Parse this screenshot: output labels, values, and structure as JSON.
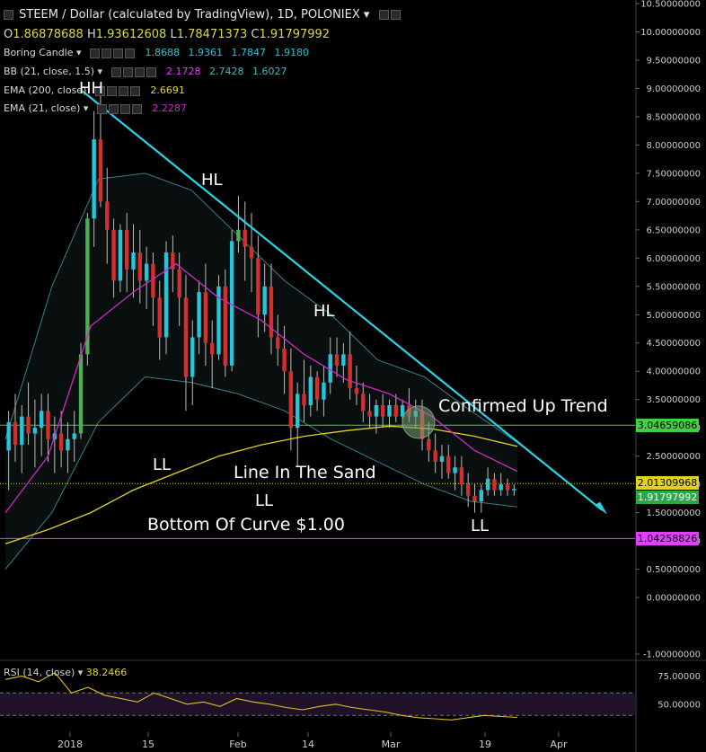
{
  "header": {
    "title": "STEEM / Dollar (calculated by TradingView), 1D, POLONIEX",
    "ohlc": {
      "o_label": "O",
      "o": "1.86878688",
      "h_label": "H",
      "h": "1.93612608",
      "l_label": "L",
      "l": "1.78471373",
      "c_label": "C",
      "c": "1.91797992"
    }
  },
  "indicators": {
    "boring_candle": {
      "label": "Boring Candle",
      "v1": "1.8688",
      "v2": "1.9361",
      "v3": "1.7847",
      "v4": "1.9180"
    },
    "bb": {
      "label": "BB (21, close, 1.5)",
      "v1": "2.1728",
      "v2": "2.7428",
      "v3": "1.6027"
    },
    "ema200": {
      "label": "EMA (200, close)",
      "v1": "2.6691"
    },
    "ema21": {
      "label": "EMA (21, close)",
      "v1": "2.2287"
    },
    "rsi": {
      "label": "RSI (14, close)",
      "v1": "38.2466"
    }
  },
  "annotations": {
    "hh": "HH",
    "hl1": "HL",
    "hl2": "HL",
    "ll1": "LL",
    "ll2": "LL",
    "ll3": "LL",
    "line_in_sand": "Line In The Sand",
    "bottom_curve": "Bottom Of Curve $1.00",
    "confirmed": "Confirmed Up Trend"
  },
  "price_tags": {
    "green_line": "3.04659086",
    "yellow_line": "2.01309968",
    "last_price": "1.91797992",
    "magenta_line": "1.04258826"
  },
  "colors": {
    "bull": "#26c6da",
    "bear": "#d32f2f",
    "bull_alt": "#4caf50",
    "trendline": "#27d3e6",
    "ema200": "#e0d31e",
    "ema21": "#d028c8",
    "bb": "#3a7f84",
    "green_line": "#3fd13f",
    "magenta_line": "#e040fb",
    "rsi": "#e0c020"
  },
  "chart_data": {
    "type": "candlestick",
    "title": "STEEM / Dollar (calculated by TradingView), 1D, POLONIEX",
    "y_axis": {
      "range": [
        -1.0,
        10.5
      ],
      "ticks": [
        "10.50000000",
        "10.00000000",
        "9.50000000",
        "9.00000000",
        "8.50000000",
        "8.00000000",
        "7.50000000",
        "7.00000000",
        "6.50000000",
        "6.00000000",
        "5.50000000",
        "5.00000000",
        "4.50000000",
        "4.00000000",
        "3.50000000",
        "3.00000000",
        "2.50000000",
        "2.00000000",
        "1.50000000",
        "1.00000000",
        "0.50000000",
        "0.00000000",
        "-1.00000000"
      ]
    },
    "x_axis": {
      "ticks": [
        "2018",
        "15",
        "Feb",
        "14",
        "Mar",
        "19",
        "Apr"
      ]
    },
    "horizontal_lines": [
      3.04659086,
      2.01309968,
      1.04258826
    ],
    "trendline": {
      "from": [
        8.95,
        "late Dec 2017"
      ],
      "to": [
        1.55,
        "end Mar 2018"
      ]
    },
    "candles": [
      [
        2.6,
        3.3,
        1.9,
        3.1
      ],
      [
        3.1,
        3.6,
        2.4,
        2.7
      ],
      [
        2.7,
        3.4,
        2.2,
        3.2
      ],
      [
        3.2,
        3.8,
        2.7,
        2.9
      ],
      [
        2.9,
        3.5,
        2.3,
        3.0
      ],
      [
        3.0,
        3.6,
        2.5,
        3.3
      ],
      [
        3.3,
        3.6,
        2.4,
        2.8
      ],
      [
        2.8,
        3.2,
        2.2,
        2.9
      ],
      [
        2.9,
        3.3,
        2.3,
        2.6
      ],
      [
        2.6,
        3.1,
        2.2,
        2.8
      ],
      [
        2.8,
        3.3,
        2.4,
        2.9
      ],
      [
        2.9,
        4.5,
        2.8,
        4.3
      ],
      [
        4.3,
        6.8,
        4.1,
        6.7
      ],
      [
        6.7,
        8.6,
        6.2,
        8.1
      ],
      [
        8.1,
        8.9,
        6.9,
        7.0
      ],
      [
        7.0,
        7.6,
        5.9,
        6.5
      ],
      [
        6.5,
        6.7,
        5.3,
        5.6
      ],
      [
        5.6,
        6.6,
        5.4,
        6.5
      ],
      [
        6.5,
        6.8,
        5.4,
        5.8
      ],
      [
        5.8,
        6.6,
        5.3,
        6.1
      ],
      [
        6.1,
        6.5,
        5.2,
        5.6
      ],
      [
        5.6,
        6.2,
        5.1,
        5.9
      ],
      [
        5.9,
        6.1,
        4.8,
        5.3
      ],
      [
        5.3,
        5.6,
        4.2,
        4.6
      ],
      [
        4.6,
        6.3,
        4.3,
        6.1
      ],
      [
        6.1,
        6.4,
        5.4,
        5.8
      ],
      [
        5.8,
        6.1,
        4.8,
        5.3
      ],
      [
        5.3,
        5.7,
        3.3,
        3.9
      ],
      [
        3.9,
        4.9,
        3.4,
        4.6
      ],
      [
        4.6,
        5.6,
        4.3,
        5.4
      ],
      [
        5.4,
        5.9,
        4.1,
        4.5
      ],
      [
        4.5,
        4.9,
        3.7,
        4.3
      ],
      [
        4.3,
        5.7,
        4.2,
        5.5
      ],
      [
        5.5,
        5.8,
        3.9,
        4.1
      ],
      [
        4.1,
        6.5,
        4.0,
        6.3
      ],
      [
        6.3,
        7.1,
        6.1,
        6.5
      ],
      [
        6.5,
        7.0,
        5.6,
        6.2
      ],
      [
        6.2,
        6.8,
        5.4,
        6.0
      ],
      [
        6.0,
        6.4,
        4.6,
        5.0
      ],
      [
        5.0,
        5.9,
        4.7,
        5.5
      ],
      [
        5.5,
        5.9,
        4.3,
        4.6
      ],
      [
        4.6,
        5.0,
        4.1,
        4.4
      ],
      [
        4.4,
        4.8,
        3.6,
        4.0
      ],
      [
        4.0,
        4.4,
        2.6,
        3.0
      ],
      [
        3.0,
        3.8,
        2.3,
        3.6
      ],
      [
        3.6,
        4.2,
        3.1,
        3.4
      ],
      [
        3.4,
        4.1,
        3.2,
        3.9
      ],
      [
        3.9,
        4.0,
        3.3,
        3.5
      ],
      [
        3.5,
        4.1,
        3.2,
        3.8
      ],
      [
        3.8,
        4.6,
        3.6,
        4.3
      ],
      [
        4.3,
        4.6,
        3.9,
        4.1
      ],
      [
        4.1,
        4.5,
        3.8,
        4.3
      ],
      [
        4.3,
        4.7,
        3.5,
        3.7
      ],
      [
        3.7,
        4.1,
        3.4,
        3.6
      ],
      [
        3.6,
        3.8,
        3.1,
        3.3
      ],
      [
        3.3,
        3.6,
        3.0,
        3.2
      ],
      [
        3.2,
        3.5,
        2.9,
        3.4
      ],
      [
        3.4,
        3.6,
        3.0,
        3.2
      ],
      [
        3.2,
        3.5,
        3.0,
        3.4
      ],
      [
        3.4,
        3.6,
        3.1,
        3.2
      ],
      [
        3.2,
        3.5,
        3.0,
        3.4
      ],
      [
        3.4,
        3.7,
        3.1,
        3.2
      ],
      [
        3.2,
        3.5,
        3.0,
        3.3
      ],
      [
        3.3,
        3.5,
        2.6,
        2.8
      ],
      [
        2.8,
        3.1,
        2.4,
        2.6
      ],
      [
        2.6,
        2.9,
        2.2,
        2.4
      ],
      [
        2.4,
        2.7,
        2.1,
        2.5
      ],
      [
        2.5,
        2.7,
        2.1,
        2.2
      ],
      [
        2.2,
        2.5,
        1.9,
        2.3
      ],
      [
        2.3,
        2.5,
        1.8,
        2.0
      ],
      [
        2.0,
        2.2,
        1.6,
        1.8
      ],
      [
        1.8,
        2.0,
        1.5,
        1.7
      ],
      [
        1.7,
        2.0,
        1.5,
        1.9
      ],
      [
        1.9,
        2.3,
        1.8,
        2.1
      ],
      [
        2.1,
        2.2,
        1.8,
        1.9
      ],
      [
        1.9,
        2.2,
        1.8,
        2.0
      ],
      [
        2.0,
        2.1,
        1.8,
        1.9
      ],
      [
        1.9,
        2.0,
        1.8,
        1.92
      ]
    ],
    "ema200": [
      0.95,
      1.2,
      1.5,
      1.9,
      2.2,
      2.5,
      2.7,
      2.85,
      2.95,
      3.03,
      2.98,
      2.85,
      2.67
    ],
    "ema21": [
      1.5,
      2.5,
      4.8,
      5.4,
      5.9,
      5.3,
      4.9,
      4.3,
      3.85,
      3.6,
      3.2,
      2.6,
      2.23
    ],
    "bb_upper": [
      2.8,
      5.5,
      7.4,
      7.5,
      7.2,
      6.4,
      5.6,
      5.0,
      4.2,
      3.9,
      3.3,
      2.74
    ],
    "bb_lower": [
      0.5,
      1.5,
      3.1,
      3.9,
      3.8,
      3.6,
      3.3,
      2.8,
      2.4,
      2.0,
      1.7,
      1.6
    ],
    "rsi": {
      "range": [
        25,
        85
      ],
      "ticks": [
        "75.00000",
        "50.00000"
      ],
      "band": [
        40,
        60
      ],
      "values": [
        72,
        75,
        70,
        78,
        60,
        65,
        58,
        55,
        52,
        60,
        55,
        50,
        52,
        48,
        55,
        52,
        50,
        47,
        45,
        48,
        50,
        47,
        45,
        43,
        40,
        38,
        37,
        36,
        38,
        40,
        39,
        38.2
      ]
    }
  }
}
